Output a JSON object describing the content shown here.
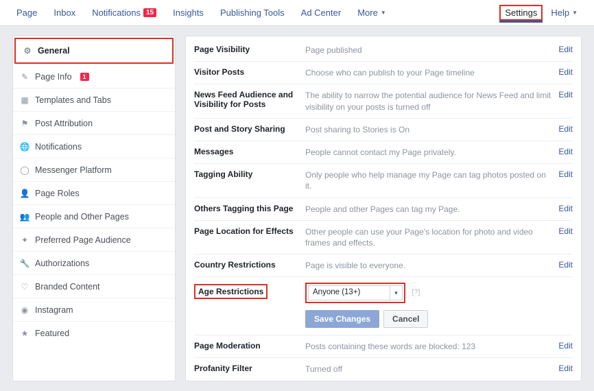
{
  "topnav": {
    "left": [
      {
        "label": "Page"
      },
      {
        "label": "Inbox"
      },
      {
        "label": "Notifications",
        "badge": "15"
      },
      {
        "label": "Insights"
      },
      {
        "label": "Publishing Tools"
      },
      {
        "label": "Ad Center"
      },
      {
        "label": "More",
        "caret": "▼"
      }
    ],
    "settings": "Settings",
    "help": "Help",
    "help_caret": "▼"
  },
  "sidebar": [
    {
      "icon": "⚙",
      "label": "General",
      "active": true,
      "highlight": true
    },
    {
      "icon": "✎",
      "label": "Page Info",
      "badge": "1"
    },
    {
      "icon": "▦",
      "label": "Templates and Tabs"
    },
    {
      "icon": "⚑",
      "label": "Post Attribution"
    },
    {
      "icon": "🌐",
      "label": "Notifications"
    },
    {
      "icon": "◯",
      "label": "Messenger Platform"
    },
    {
      "icon": "👤",
      "label": "Page Roles"
    },
    {
      "icon": "👥",
      "label": "People and Other Pages"
    },
    {
      "icon": "✦",
      "label": "Preferred Page Audience"
    },
    {
      "icon": "🔧",
      "label": "Authorizations"
    },
    {
      "icon": "♡",
      "label": "Branded Content"
    },
    {
      "icon": "◉",
      "label": "Instagram"
    },
    {
      "icon": "★",
      "label": "Featured"
    }
  ],
  "settings_rows": [
    {
      "label": "Page Visibility",
      "value": "Page published",
      "edit": "Edit"
    },
    {
      "label": "Visitor Posts",
      "value": "Choose who can publish to your Page timeline",
      "edit": "Edit"
    },
    {
      "label": "News Feed Audience and Visibility for Posts",
      "value": "The ability to narrow the potential audience for News Feed and limit visibility on your posts is turned off",
      "edit": "Edit"
    },
    {
      "label": "Post and Story Sharing",
      "value": "Post sharing to Stories is On",
      "edit": "Edit"
    },
    {
      "label": "Messages",
      "value": "People cannot contact my Page privately.",
      "edit": "Edit"
    },
    {
      "label": "Tagging Ability",
      "value": "Only people who help manage my Page can tag photos posted on it.",
      "edit": "Edit"
    },
    {
      "label": "Others Tagging this Page",
      "value": "People and other Pages can tag my Page.",
      "edit": "Edit"
    },
    {
      "label": "Page Location for Effects",
      "value": "Other people can use your Page's location for photo and video frames and effects.",
      "edit": "Edit"
    },
    {
      "label": "Country Restrictions",
      "value": "Page is visible to everyone.",
      "edit": "Edit"
    }
  ],
  "age_restrictions": {
    "label": "Age Restrictions",
    "selected": "Anyone (13+)",
    "help": "[?]",
    "save": "Save Changes",
    "cancel": "Cancel"
  },
  "after_rows": [
    {
      "label": "Page Moderation",
      "value": "Posts containing these words are blocked: 123",
      "edit": "Edit"
    },
    {
      "label": "Profanity Filter",
      "value": "Turned off",
      "edit": "Edit"
    }
  ]
}
